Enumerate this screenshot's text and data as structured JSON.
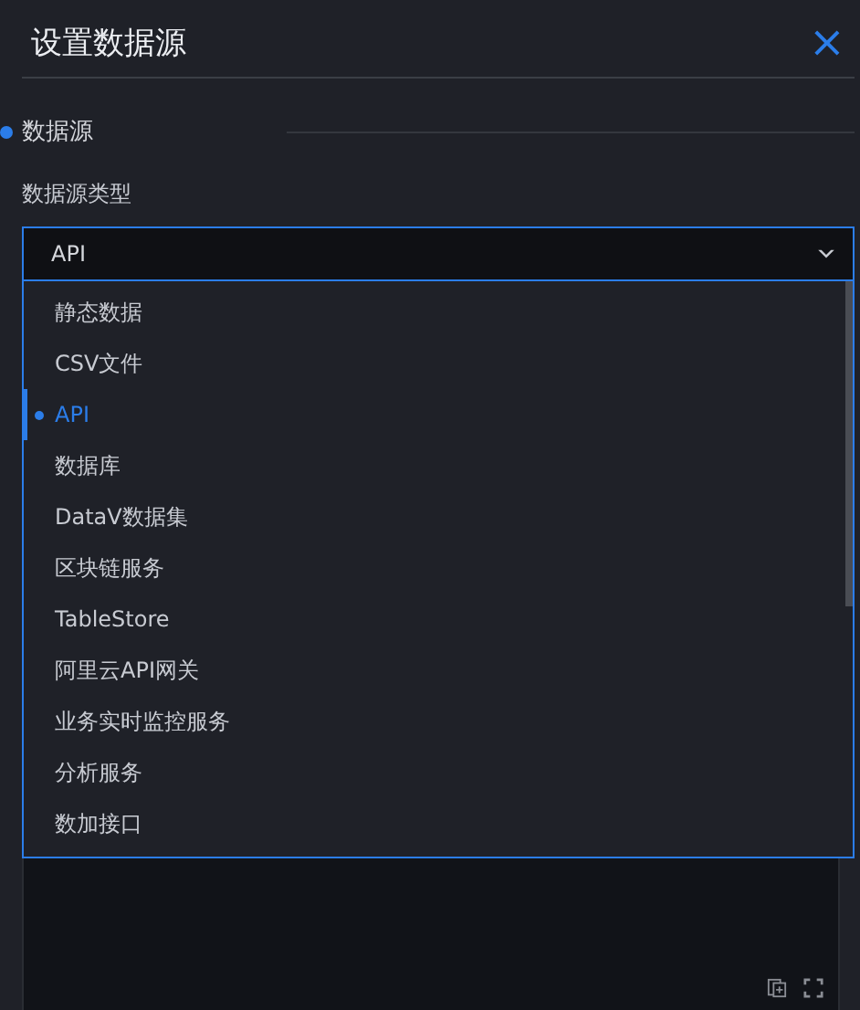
{
  "dialog": {
    "title": "设置数据源",
    "close": "×"
  },
  "section": {
    "title": "数据源"
  },
  "field": {
    "label": "数据源类型",
    "value": "API",
    "expanded": true
  },
  "options": [
    {
      "label": "静态数据",
      "selected": false
    },
    {
      "label": "CSV文件",
      "selected": false
    },
    {
      "label": "API",
      "selected": true
    },
    {
      "label": "数据库",
      "selected": false
    },
    {
      "label": "DataV数据集",
      "selected": false
    },
    {
      "label": "区块链服务",
      "selected": false
    },
    {
      "label": "TableStore",
      "selected": false
    },
    {
      "label": "阿里云API网关",
      "selected": false
    },
    {
      "label": "业务实时监控服务",
      "selected": false
    },
    {
      "label": "分析服务",
      "selected": false
    },
    {
      "label": "数加接口",
      "selected": false
    }
  ]
}
